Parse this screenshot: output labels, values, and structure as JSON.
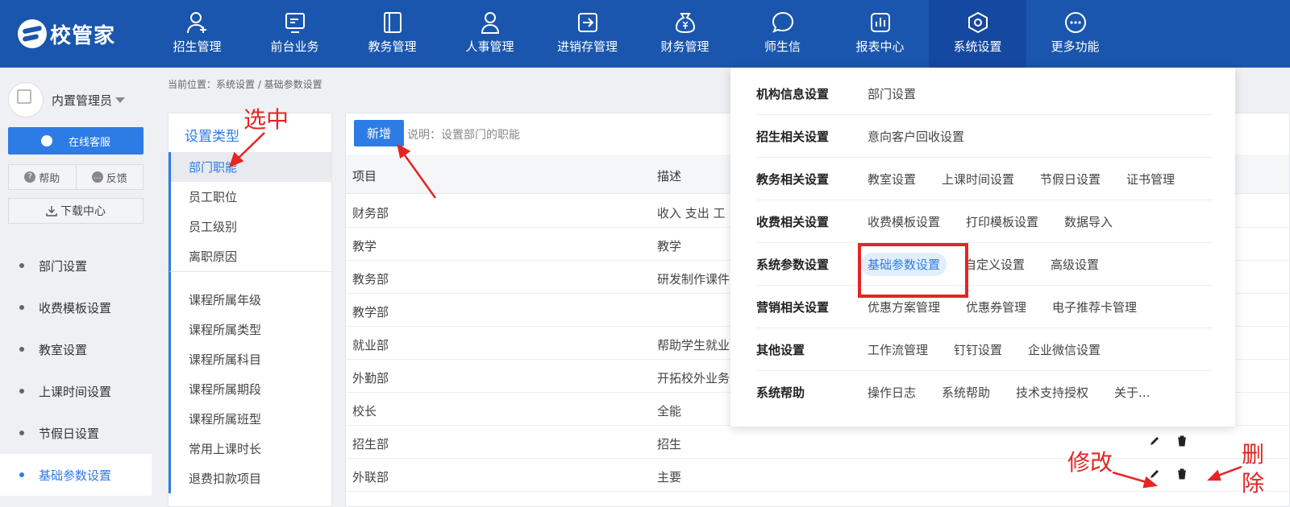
{
  "app": {
    "logo_text": "校管家"
  },
  "nav": [
    {
      "label": "招生管理",
      "icon": "person-add-icon"
    },
    {
      "label": "前台业务",
      "icon": "monitor-icon"
    },
    {
      "label": "教务管理",
      "icon": "book-icon"
    },
    {
      "label": "人事管理",
      "icon": "person-icon"
    },
    {
      "label": "进销存管理",
      "icon": "arrow-in-box-icon"
    },
    {
      "label": "财务管理",
      "icon": "money-bag-icon"
    },
    {
      "label": "师生信",
      "icon": "chat-bubble-icon"
    },
    {
      "label": "报表中心",
      "icon": "bar-chart-icon"
    },
    {
      "label": "系统设置",
      "icon": "settings-icon",
      "active": true
    },
    {
      "label": "更多功能",
      "icon": "more-dots-icon"
    }
  ],
  "sidebar": {
    "user_name": "内置管理员",
    "service_label": "在线客服",
    "help_label": "帮助",
    "help_icon_text": "?",
    "feedback_label": "反馈",
    "feedback_icon_text": "…",
    "download_label": "下载中心",
    "menu": [
      {
        "label": "部门设置"
      },
      {
        "label": "收费模板设置"
      },
      {
        "label": "教室设置"
      },
      {
        "label": "上课时间设置"
      },
      {
        "label": "节假日设置"
      },
      {
        "label": "基础参数设置",
        "active": true
      }
    ]
  },
  "breadcrumb": "当前位置：系统设置 / 基础参数设置",
  "settings_types": {
    "title": "设置类型",
    "group1": [
      "部门职能",
      "员工职位",
      "员工级别",
      "离职原因"
    ],
    "group2": [
      "课程所属年级",
      "课程所属类型",
      "课程所属科目",
      "课程所属期段",
      "课程所属班型",
      "常用上课时长",
      "退费扣款项目"
    ]
  },
  "content": {
    "add_label": "新增",
    "note": "说明：设置部门的职能",
    "headers": {
      "item": "项目",
      "desc": "描述"
    },
    "rows": [
      {
        "item": "财务部",
        "desc": "收入 支出 工"
      },
      {
        "item": "教学",
        "desc": "教学"
      },
      {
        "item": "教务部",
        "desc": "研发制作课件"
      },
      {
        "item": "教学部",
        "desc": ""
      },
      {
        "item": "就业部",
        "desc": "帮助学生就业"
      },
      {
        "item": "外勤部",
        "desc": "开拓校外业务"
      },
      {
        "item": "校长",
        "desc": "全能"
      },
      {
        "item": "招生部",
        "desc": "招生"
      },
      {
        "item": "外联部",
        "desc": "主要"
      }
    ]
  },
  "dropdown": [
    {
      "category": "机构信息设置",
      "links": [
        "部门设置"
      ]
    },
    {
      "category": "招生相关设置",
      "links": [
        "意向客户回收设置"
      ]
    },
    {
      "category": "教务相关设置",
      "links": [
        "教室设置",
        "上课时间设置",
        "节假日设置",
        "证书管理"
      ]
    },
    {
      "category": "收费相关设置",
      "links": [
        "收费模板设置",
        "打印模板设置",
        "数据导入"
      ]
    },
    {
      "category": "系统参数设置",
      "links": [
        "基础参数设置",
        "自定义设置",
        "高级设置"
      ],
      "selected": 0
    },
    {
      "category": "营销相关设置",
      "links": [
        "优惠方案管理",
        "优惠券管理",
        "电子推荐卡管理"
      ]
    },
    {
      "category": "其他设置",
      "links": [
        "工作流管理",
        "钉钉设置",
        "企业微信设置"
      ]
    },
    {
      "category": "系统帮助",
      "links": [
        "操作日志",
        "系统帮助",
        "技术支持授权",
        "关于..."
      ]
    }
  ],
  "annotations": {
    "selected": "选中",
    "modify": "修改",
    "delete_1": "删",
    "delete_2": "除"
  },
  "colors": {
    "nav_bg": "#1a56ad",
    "accent": "#2d7ce6",
    "annotation": "#e52424"
  }
}
